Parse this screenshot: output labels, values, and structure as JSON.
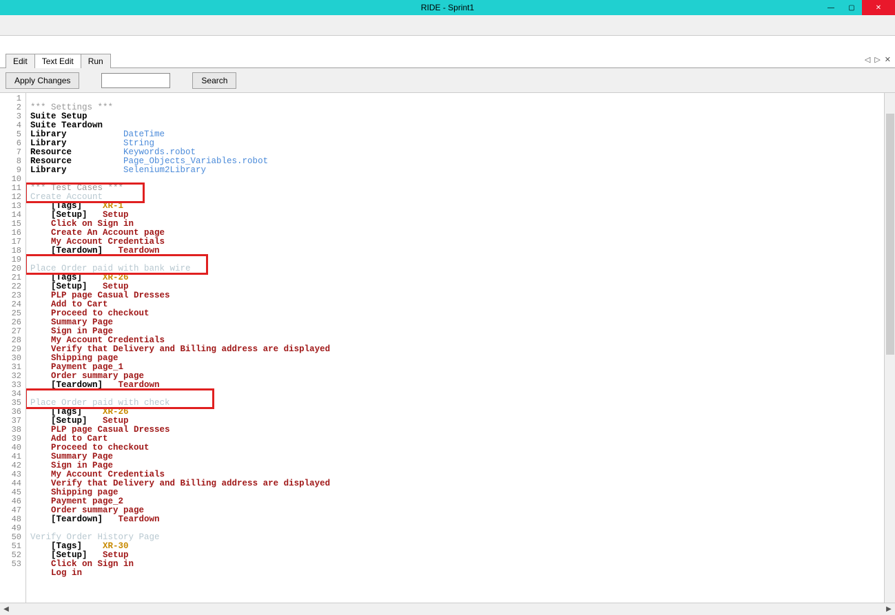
{
  "window": {
    "title": "RIDE - Sprint1"
  },
  "window_controls": {
    "min": "—",
    "max": "▢",
    "close": "✕"
  },
  "tabs": {
    "edit": "Edit",
    "textedit": "Text Edit",
    "run": "Run"
  },
  "tab_nav": {
    "prev": "◁",
    "next": "▷",
    "close": "✕"
  },
  "toolbar": {
    "apply": "Apply Changes",
    "search": "Search"
  },
  "code": {
    "lines": 53,
    "l1": "*** Settings ***",
    "l2": "Suite Setup",
    "l3": "Suite Teardown",
    "l4_k": "Library",
    "l4_v": "DateTime",
    "l5_k": "Library",
    "l5_v": "String",
    "l6_k": "Resource",
    "l6_v": "Keywords.robot",
    "l7_k": "Resource",
    "l7_v": "Page_Objects_Variables.robot",
    "l8_k": "Library",
    "l8_v": "Selenium2Library",
    "l10": "*** Test Cases ***",
    "tc1_name": "Create Account",
    "tc1_tags_k": "[Tags]",
    "tc1_tags_v": "XR-1",
    "tc1_setup_k": "[Setup]",
    "tc1_setup_v": "Setup",
    "tc1_s1": "Click on Sign in",
    "tc1_s2": "Create An Account page",
    "tc1_s3": "My Account Credentials",
    "tc1_td_k": "[Teardown]",
    "tc1_td_v": "Teardown",
    "tc2_name": "Place Order paid with bank wire",
    "tc2_tags_k": "[Tags]",
    "tc2_tags_v": "XR-26",
    "tc2_setup_k": "[Setup]",
    "tc2_setup_v": "Setup",
    "tc2_s1": "PLP page Casual Dresses",
    "tc2_s2": "Add to Cart",
    "tc2_s3": "Proceed to checkout",
    "tc2_s4": "Summary Page",
    "tc2_s5": "Sign in Page",
    "tc2_s6": "My Account Credentials",
    "tc2_s7": "Verify that Delivery and Billing address are displayed",
    "tc2_s8": "Shipping page",
    "tc2_s9": "Payment page_1",
    "tc2_s10": "Order summary page",
    "tc2_td_k": "[Teardown]",
    "tc2_td_v": "Teardown",
    "tc3_name": "Place Order paid with check",
    "tc3_tags_k": "[Tags]",
    "tc3_tags_v": "XR-26",
    "tc3_setup_k": "[Setup]",
    "tc3_setup_v": "Setup",
    "tc3_s1": "PLP page Casual Dresses",
    "tc3_s2": "Add to Cart",
    "tc3_s3": "Proceed to checkout",
    "tc3_s4": "Summary Page",
    "tc3_s5": "Sign in Page",
    "tc3_s6": "My Account Credentials",
    "tc3_s7": "Verify that Delivery and Billing address are displayed",
    "tc3_s8": "Shipping page",
    "tc3_s9": "Payment page_2",
    "tc3_s10": "Order summary page",
    "tc3_td_k": "[Teardown]",
    "tc3_td_v": "Teardown",
    "tc4_name": "Verify Order History Page",
    "tc4_tags_k": "[Tags]",
    "tc4_tags_v": "XR-30",
    "tc4_setup_k": "[Setup]",
    "tc4_setup_v": "Setup",
    "tc4_s1": "Click on Sign in",
    "tc4_s2": "Log in"
  }
}
